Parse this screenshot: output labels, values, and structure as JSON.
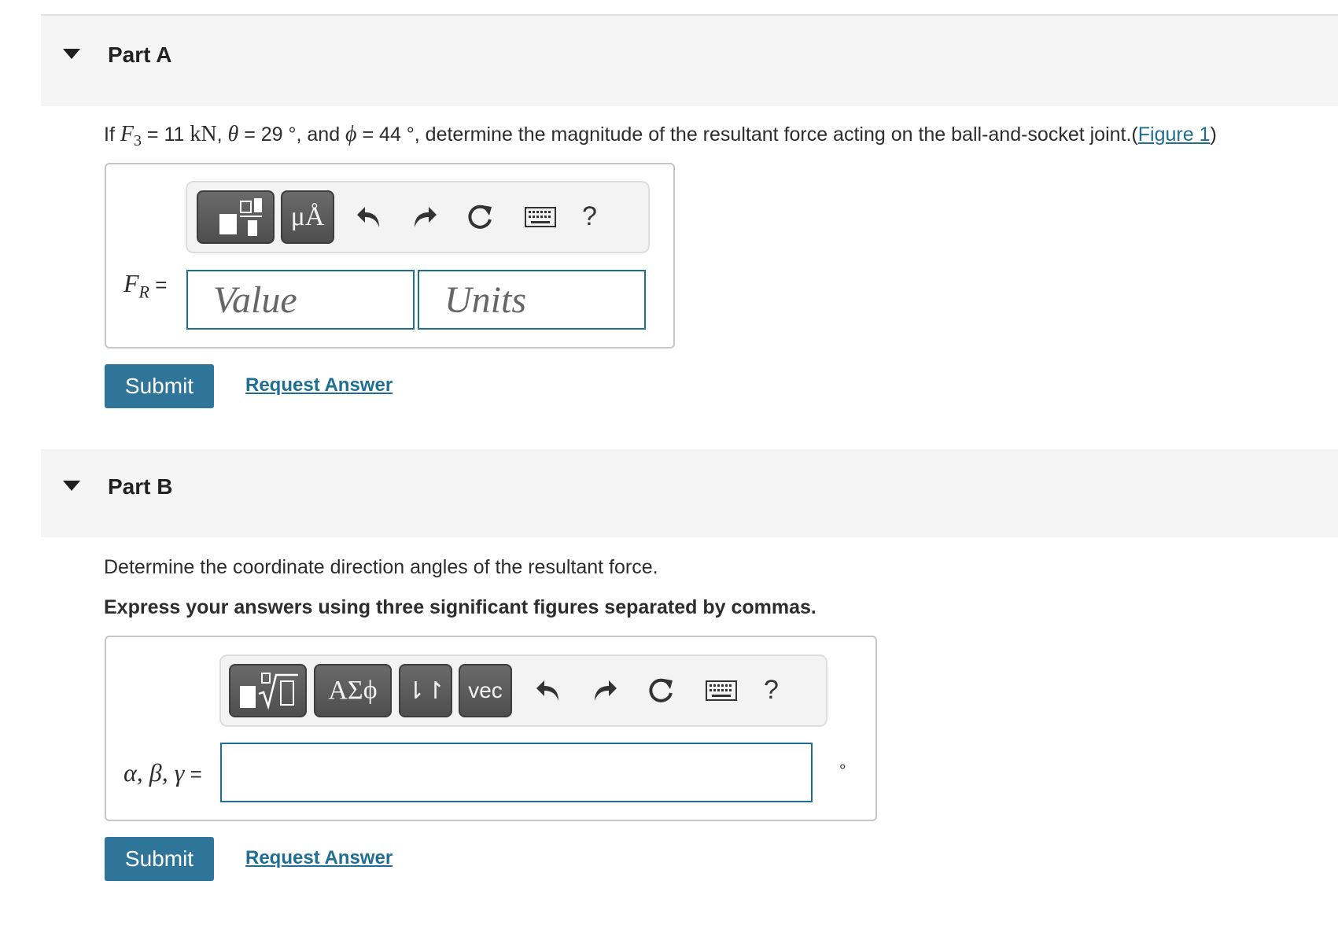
{
  "partA": {
    "title": "Part A",
    "prompt": {
      "if": "If ",
      "f3_var": "F",
      "f3_sub": "3",
      "eq1": " = 11 ",
      "unit_kN": "kN",
      "comma1": ", ",
      "theta": "θ",
      "eq2": " = 29 °, and ",
      "phi": "ϕ",
      "eq3": " = 44 °, determine the magnitude of the resultant force acting on the ball-and-socket joint.(",
      "figure_link": "Figure 1",
      "close": ")"
    },
    "toolbar": {
      "units_button": "μÅ",
      "help": "?"
    },
    "label": {
      "var": "F",
      "sub": "R",
      "eq": " ="
    },
    "value_placeholder": "Value",
    "units_placeholder": "Units",
    "submit": "Submit",
    "request_answer": "Request Answer"
  },
  "partB": {
    "title": "Part B",
    "prompt": "Determine the coordinate direction angles of the resultant force.",
    "instruction": "Express your answers using three significant figures separated by commas.",
    "toolbar": {
      "greek_button": "ΑΣϕ",
      "arrows_button": "⇂↾",
      "vec_button": "vec",
      "help": "?"
    },
    "label": {
      "vars": "α, β, γ",
      "eq": " ="
    },
    "answer_value": "",
    "unit_suffix": "∘",
    "submit": "Submit",
    "request_answer": "Request Answer"
  },
  "icons": {
    "template": "template-icon",
    "radical": "radical-template-icon",
    "undo": "undo-icon",
    "redo": "redo-icon",
    "reset": "reset-icon",
    "keyboard": "keyboard-icon"
  },
  "colors": {
    "accent": "#2e7599",
    "link": "#1f6f94",
    "header_bg": "#f5f5f5"
  }
}
